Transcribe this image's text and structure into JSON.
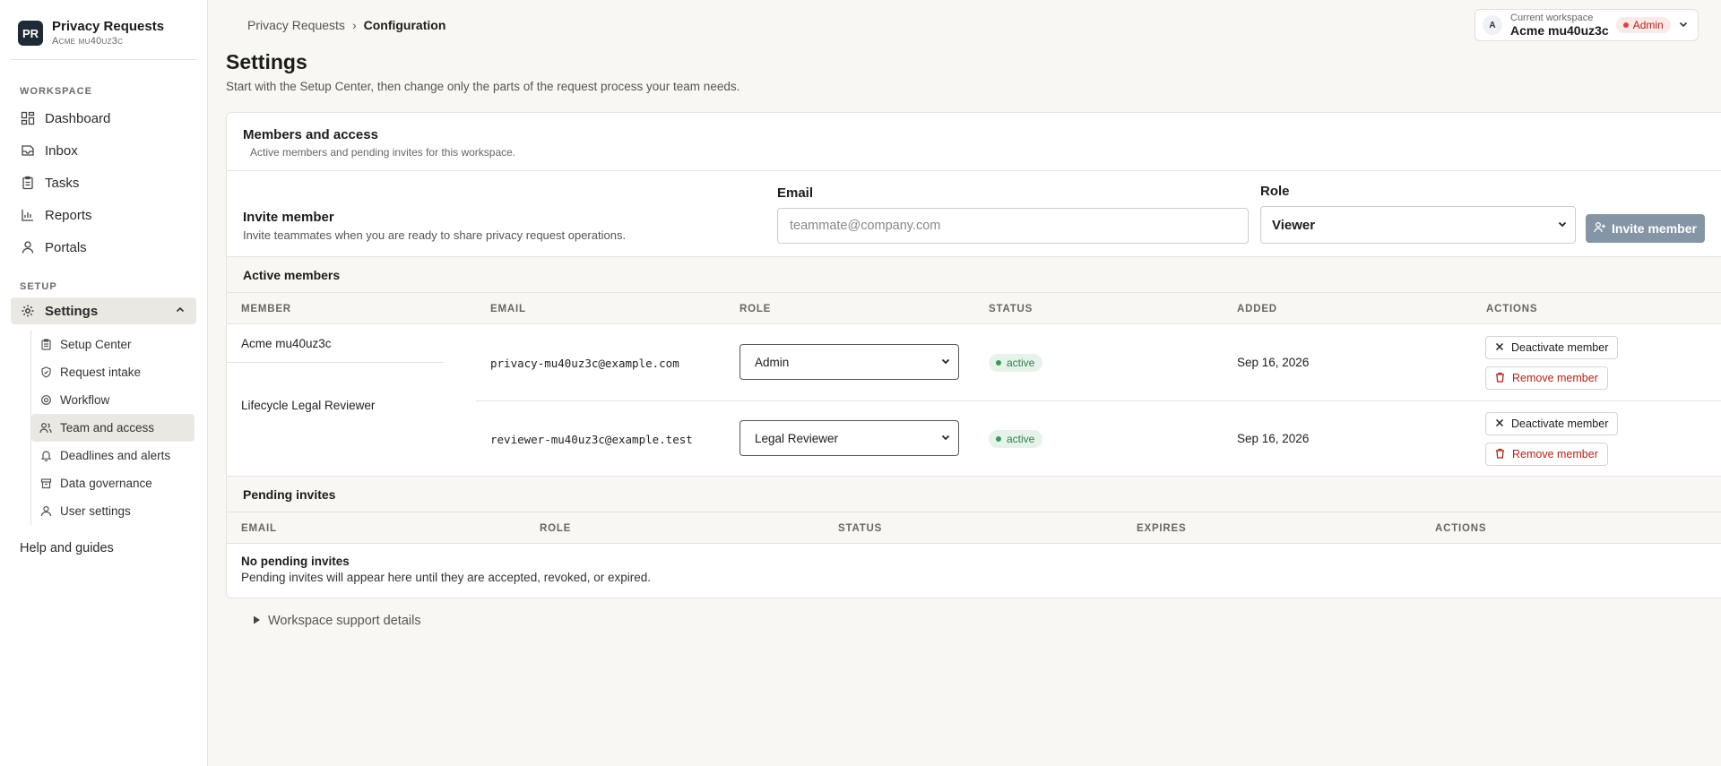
{
  "brand": {
    "logo": "PR",
    "title": "Privacy Requests",
    "subtitle": "Acme mu40uz3c"
  },
  "sidebar": {
    "workspace_label": "WORKSPACE",
    "workspace_items": [
      {
        "label": "Dashboard",
        "icon": "dashboard-icon"
      },
      {
        "label": "Inbox",
        "icon": "inbox-icon"
      },
      {
        "label": "Tasks",
        "icon": "tasks-icon"
      },
      {
        "label": "Reports",
        "icon": "reports-icon"
      },
      {
        "label": "Portals",
        "icon": "portals-icon"
      }
    ],
    "setup_label": "SETUP",
    "settings_label": "Settings",
    "settings_sub": [
      {
        "label": "Setup Center",
        "icon": "clipboard-icon"
      },
      {
        "label": "Request intake",
        "icon": "shield-check-icon"
      },
      {
        "label": "Workflow",
        "icon": "gear-icon"
      },
      {
        "label": "Team and access",
        "icon": "users-icon",
        "active": true
      },
      {
        "label": "Deadlines and alerts",
        "icon": "bell-icon"
      },
      {
        "label": "Data governance",
        "icon": "archive-icon"
      },
      {
        "label": "User settings",
        "icon": "user-icon"
      }
    ],
    "help_label": "Help and guides"
  },
  "breadcrumb": {
    "parent": "Privacy Requests",
    "separator": "›",
    "current": "Configuration"
  },
  "workspace": {
    "avatar": "A",
    "label": "Current workspace",
    "name": "Acme mu40uz3c",
    "role": "Admin"
  },
  "page": {
    "title": "Settings",
    "subtitle": "Start with the Setup Center, then change only the parts of the request process your team needs."
  },
  "members_card": {
    "title": "Members and access",
    "description": "Active members and pending invites for this workspace.",
    "invite": {
      "title": "Invite member",
      "description": "Invite teammates when you are ready to share privacy request operations.",
      "email_label": "Email",
      "email_placeholder": "teammate@company.com",
      "role_label": "Role",
      "role_value": "Viewer",
      "button_label": "Invite member"
    },
    "active_title": "Active members",
    "active_columns": [
      "MEMBER",
      "EMAIL",
      "ROLE",
      "STATUS",
      "ADDED",
      "ACTIONS"
    ],
    "members": [
      {
        "name": "Acme mu40uz3c",
        "email": "privacy-mu40uz3c@example.com",
        "role": "Admin",
        "status": "active",
        "added": "Sep 16, 2026",
        "deactivate": "Deactivate member",
        "remove": "Remove member"
      },
      {
        "name": "Lifecycle Legal Reviewer",
        "email": "reviewer-mu40uz3c@example.test",
        "role": "Legal Reviewer",
        "status": "active",
        "added": "Sep 16, 2026",
        "deactivate": "Deactivate member",
        "remove": "Remove member"
      }
    ],
    "pending_title": "Pending invites",
    "pending_columns": [
      "EMAIL",
      "ROLE",
      "STATUS",
      "EXPIRES",
      "ACTIONS"
    ],
    "pending_empty_title": "No pending invites",
    "pending_empty_desc": "Pending invites will appear here until they are accepted, revoked, or expired."
  },
  "support_label": "Workspace support details",
  "colors": {
    "accent": "#1e2a36",
    "invite_button": "#8496a6",
    "danger": "#b42318",
    "success": "#2e7d4f"
  }
}
